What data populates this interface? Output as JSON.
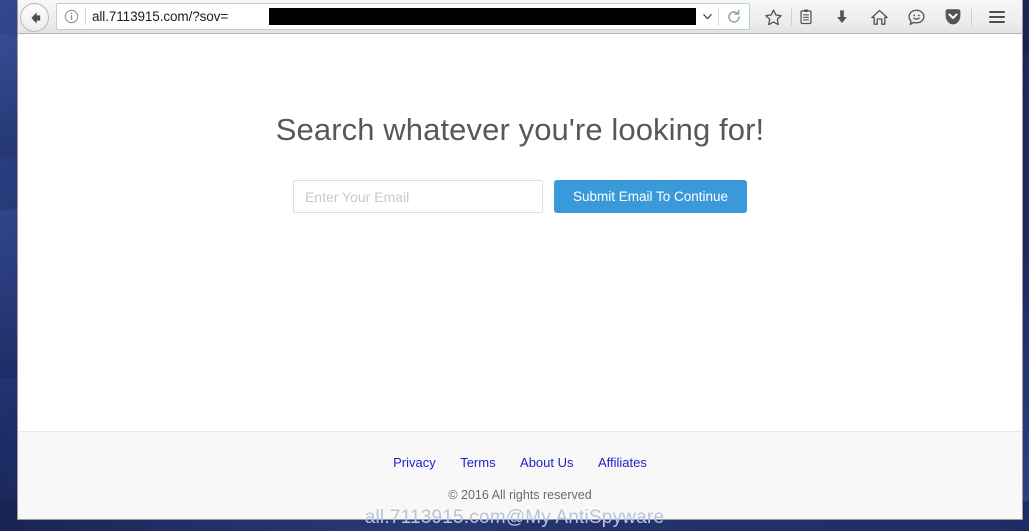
{
  "browser": {
    "back_button": "back-arrow",
    "urlbar": {
      "identity_icon": "info-circle-icon",
      "url_visible": "all.7113915.com/?sov=",
      "redacted": true,
      "dropdown_icon": "chevron-down-icon",
      "reload_icon": "reload-icon"
    },
    "toolbar_icons": [
      {
        "name": "bookmark-star-icon",
        "glyph": "star"
      },
      {
        "name": "reader-list-icon",
        "glyph": "clipboard"
      },
      {
        "name": "downloads-icon",
        "glyph": "down-arrow"
      },
      {
        "name": "home-icon",
        "glyph": "home"
      },
      {
        "name": "sync-chat-icon",
        "glyph": "smiley"
      },
      {
        "name": "pocket-icon",
        "glyph": "shield"
      },
      {
        "name": "menu-icon",
        "glyph": "hamburger"
      }
    ]
  },
  "page": {
    "heading": "Search whatever you're looking for!",
    "form": {
      "email_placeholder": "Enter Your Email",
      "email_value": "",
      "submit_label": "Submit Email To Continue"
    },
    "footer": {
      "links": [
        {
          "label": "Privacy"
        },
        {
          "label": "Terms"
        },
        {
          "label": "About Us"
        },
        {
          "label": "Affiliates"
        }
      ],
      "copyright": "© 2016 All rights reserved"
    }
  },
  "watermark": "all.7113915.com@My AntiSpyware",
  "colors": {
    "accent_blue": "#3a9ad9",
    "link_blue": "#2222cc",
    "heading_gray": "#56595b",
    "footer_bg": "#f8f8f8",
    "desktop_blue": "#1f2f6b"
  }
}
